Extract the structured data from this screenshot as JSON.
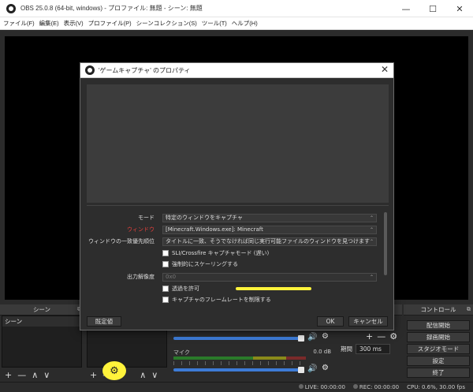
{
  "window": {
    "title": "OBS 25.0.8 (64-bit, windows) - プロファイル: 無題 - シーン: 無題",
    "minimize": "—",
    "maximize": "☐",
    "close": "✕"
  },
  "menubar": {
    "items": [
      "ファイル(F)",
      "編集(E)",
      "表示(V)",
      "プロファイル(P)",
      "シーンコレクション(S)",
      "ツール(T)",
      "ヘルプ(H)"
    ]
  },
  "docks": {
    "scenes_title": "シーン",
    "scene_items": [
      "シーン"
    ],
    "add": "+",
    "remove": "—",
    "up": "∧",
    "down": "∨",
    "sources_gear": "⚙",
    "mixer": {
      "tracks": [
        {
          "name": "",
          "db": ""
        },
        {
          "name": "マイク",
          "db": "0.0 dB"
        }
      ]
    },
    "transitions": {
      "duration_label": "期間",
      "duration_value": "300 ms"
    },
    "controls": {
      "title": "コントロール",
      "buttons": [
        "配信開始",
        "録画開始",
        "スタジオモード",
        "設定",
        "終了"
      ]
    }
  },
  "status": {
    "live": "LIVE: 00:00:00",
    "rec": "REC: 00:00:00",
    "cpu": "CPU: 0.6%, 30.00 fps"
  },
  "dialog": {
    "title": "'ゲームキャプチャ' のプロパティ",
    "close": "✕",
    "properties": [
      {
        "label": "モード",
        "value": "特定のウィンドウをキャプチャ",
        "style": "normal"
      },
      {
        "label": "ウィンドウ",
        "value": "[Minecraft.Windows.exe]: Minecraft",
        "style": "red"
      },
      {
        "label": "ウィンドウの一致優先順位",
        "value": "タイトルに一致、そうでなければ同じ実行可能ファイルのウィンドウを見つけます",
        "style": "normal"
      }
    ],
    "checkboxes": [
      {
        "label": "SLI/Crossfire キャプチャモード (遅い)",
        "checked": false
      },
      {
        "label": "強制的にスケーリングする",
        "checked": false
      }
    ],
    "output_resolution_label": "出力解像度",
    "output_resolution_value": "0x0",
    "checkboxes2": [
      {
        "label": "透過を許可",
        "checked": false
      },
      {
        "label": "キャプチャのフレームレートを制限する",
        "checked": false
      }
    ],
    "defaults_button": "既定値",
    "ok_button": "OK",
    "cancel_button": "キャンセル"
  },
  "colors": {
    "highlight": "#fff33b",
    "warning_label": "#e0403c",
    "volume_slider": "#3d7bd6"
  }
}
